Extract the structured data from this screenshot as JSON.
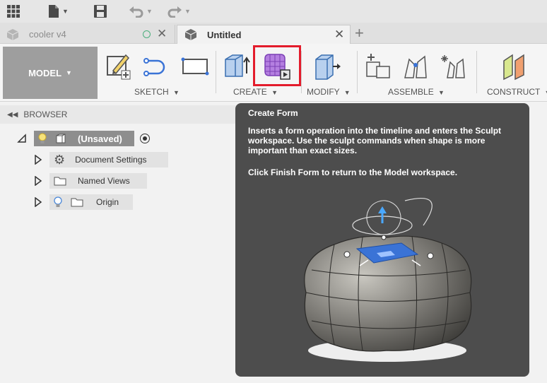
{
  "app": {
    "tabs": [
      {
        "label": "cooler v4",
        "active": false
      },
      {
        "label": "Untitled",
        "active": true
      }
    ],
    "workspace_label": "MODEL",
    "ribbon_groups": [
      {
        "label": "SKETCH"
      },
      {
        "label": "CREATE"
      },
      {
        "label": "MODIFY"
      },
      {
        "label": "ASSEMBLE"
      },
      {
        "label": "CONSTRUCT"
      }
    ]
  },
  "browser": {
    "header": "BROWSER",
    "root_label": "(Unsaved)",
    "items": [
      {
        "label": "Document Settings"
      },
      {
        "label": "Named Views"
      },
      {
        "label": "Origin"
      }
    ]
  },
  "tooltip": {
    "title": "Create Form",
    "description": "Inserts a form operation into the timeline and enters the Sculpt workspace. Use the sculpt commands when shape is more important than exact sizes.",
    "note": "Click Finish Form to return to the Model workspace."
  },
  "colors": {
    "highlight": "#e31c2c",
    "tooltip_bg": "#4d4d4d",
    "accent_blue": "#3a73d6"
  }
}
